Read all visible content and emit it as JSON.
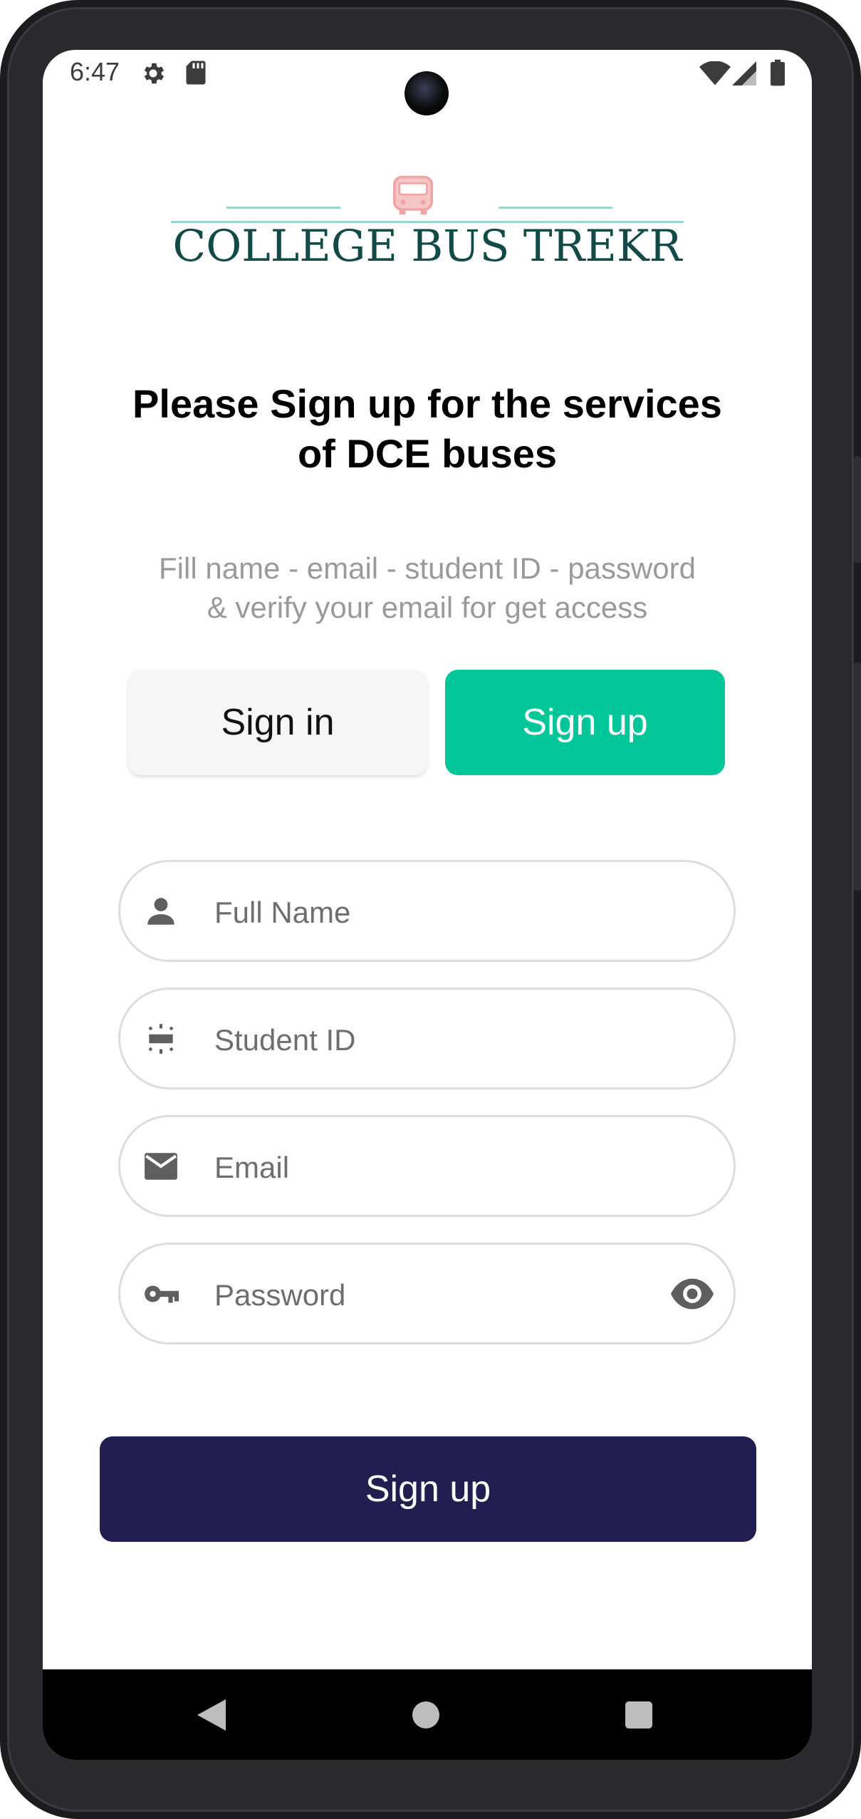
{
  "status_bar": {
    "time": "6:47",
    "icons": [
      "gear-icon",
      "sd-card-icon",
      "wifi-icon",
      "signal-icon",
      "battery-icon"
    ]
  },
  "logo": {
    "text": "COLLEGE BUS TREKR",
    "icon": "bus-icon",
    "text_color": "#124a47",
    "accent_color": "#9ad4cf"
  },
  "header": {
    "title_line1": "Please Sign up for the services",
    "title_line2": "of DCE buses",
    "subtitle_line1": "Fill name - email - student ID - password",
    "subtitle_line2": "& verify your email for get access"
  },
  "tabs": [
    {
      "label": "Sign in",
      "active": false
    },
    {
      "label": "Sign up",
      "active": true
    }
  ],
  "form": {
    "full_name": {
      "placeholder": "Full Name",
      "value": "",
      "icon": "person-icon"
    },
    "student_id": {
      "placeholder": "Student ID",
      "value": "",
      "icon": "badge-icon"
    },
    "email": {
      "placeholder": "Email",
      "value": "",
      "icon": "envelope-icon"
    },
    "password": {
      "placeholder": "Password",
      "value": "",
      "icon": "key-icon",
      "toggle_icon": "eye-icon"
    }
  },
  "submit": {
    "label": "Sign up",
    "color": "#221f50"
  },
  "colors": {
    "accent": "#00c69a",
    "muted_text": "#9a9a9a"
  },
  "nav_bar": {
    "icons": [
      "back-icon",
      "home-icon",
      "recents-icon"
    ]
  }
}
